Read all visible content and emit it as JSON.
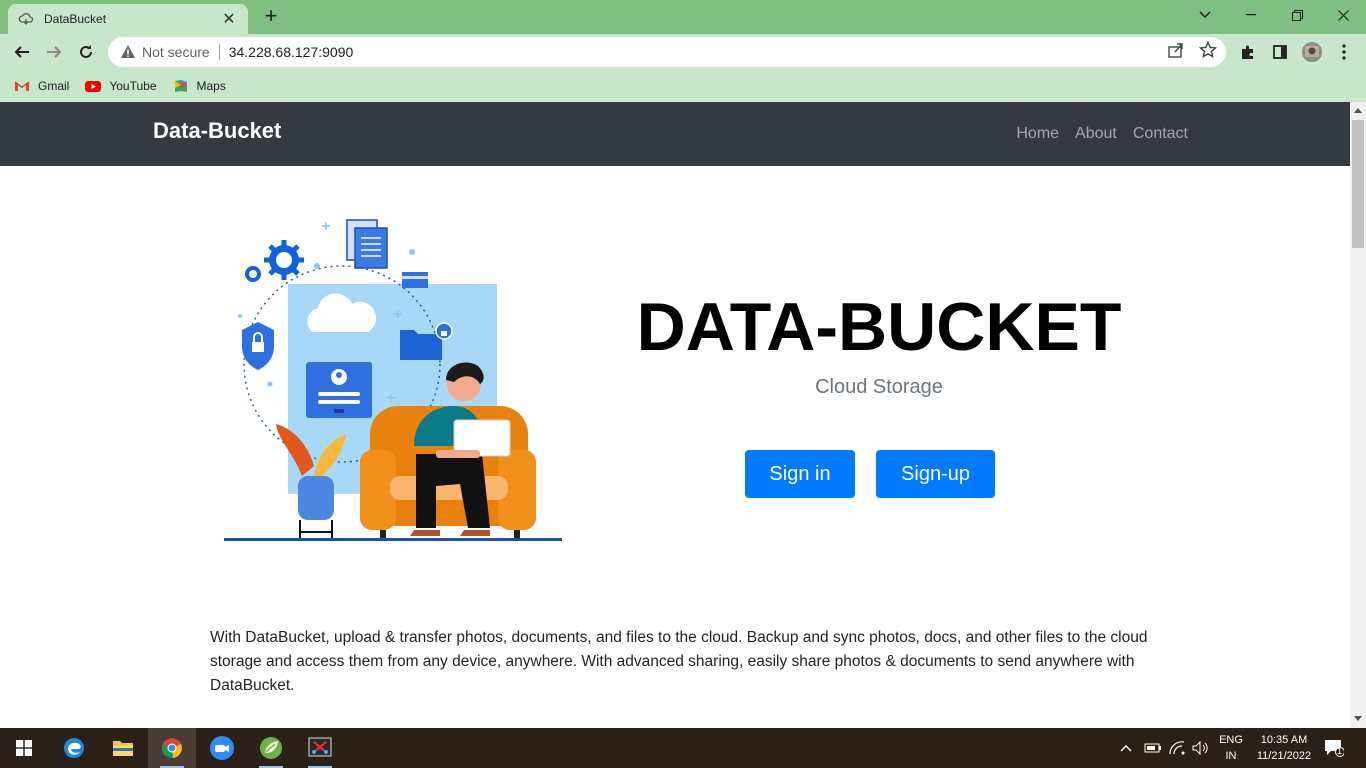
{
  "browser": {
    "tab_title": "DataBucket",
    "new_tab": "+",
    "security_label": "Not secure",
    "url": "34.228.68.127:9090",
    "bookmarks": [
      {
        "label": "Gmail",
        "icon": "gmail-icon"
      },
      {
        "label": "YouTube",
        "icon": "youtube-icon"
      },
      {
        "label": "Maps",
        "icon": "maps-icon"
      }
    ]
  },
  "site": {
    "brand": "Data-Bucket",
    "nav": [
      "Home",
      "About",
      "Contact"
    ],
    "hero_title": "DATA-BUCKET",
    "hero_subtitle": "Cloud Storage",
    "signin_label": "Sign in",
    "signup_label": "Sign-up",
    "description": "With DataBucket, upload & transfer photos, documents, and files to the cloud. Backup and sync photos, docs, and other files to the cloud storage and access them from any device, anywhere. With advanced sharing, easily share photos & documents to send anywhere with DataBucket."
  },
  "taskbar": {
    "lang_line1": "ENG",
    "lang_line2": "IN",
    "time": "10:35 AM",
    "date": "11/21/2022",
    "notification_count": "1"
  },
  "colors": {
    "titlebar": "#7fbf7f",
    "toolbar": "#c8e6c9",
    "site_nav": "#343a40",
    "primary_button": "#007bff",
    "taskbar": "#2b2118"
  }
}
